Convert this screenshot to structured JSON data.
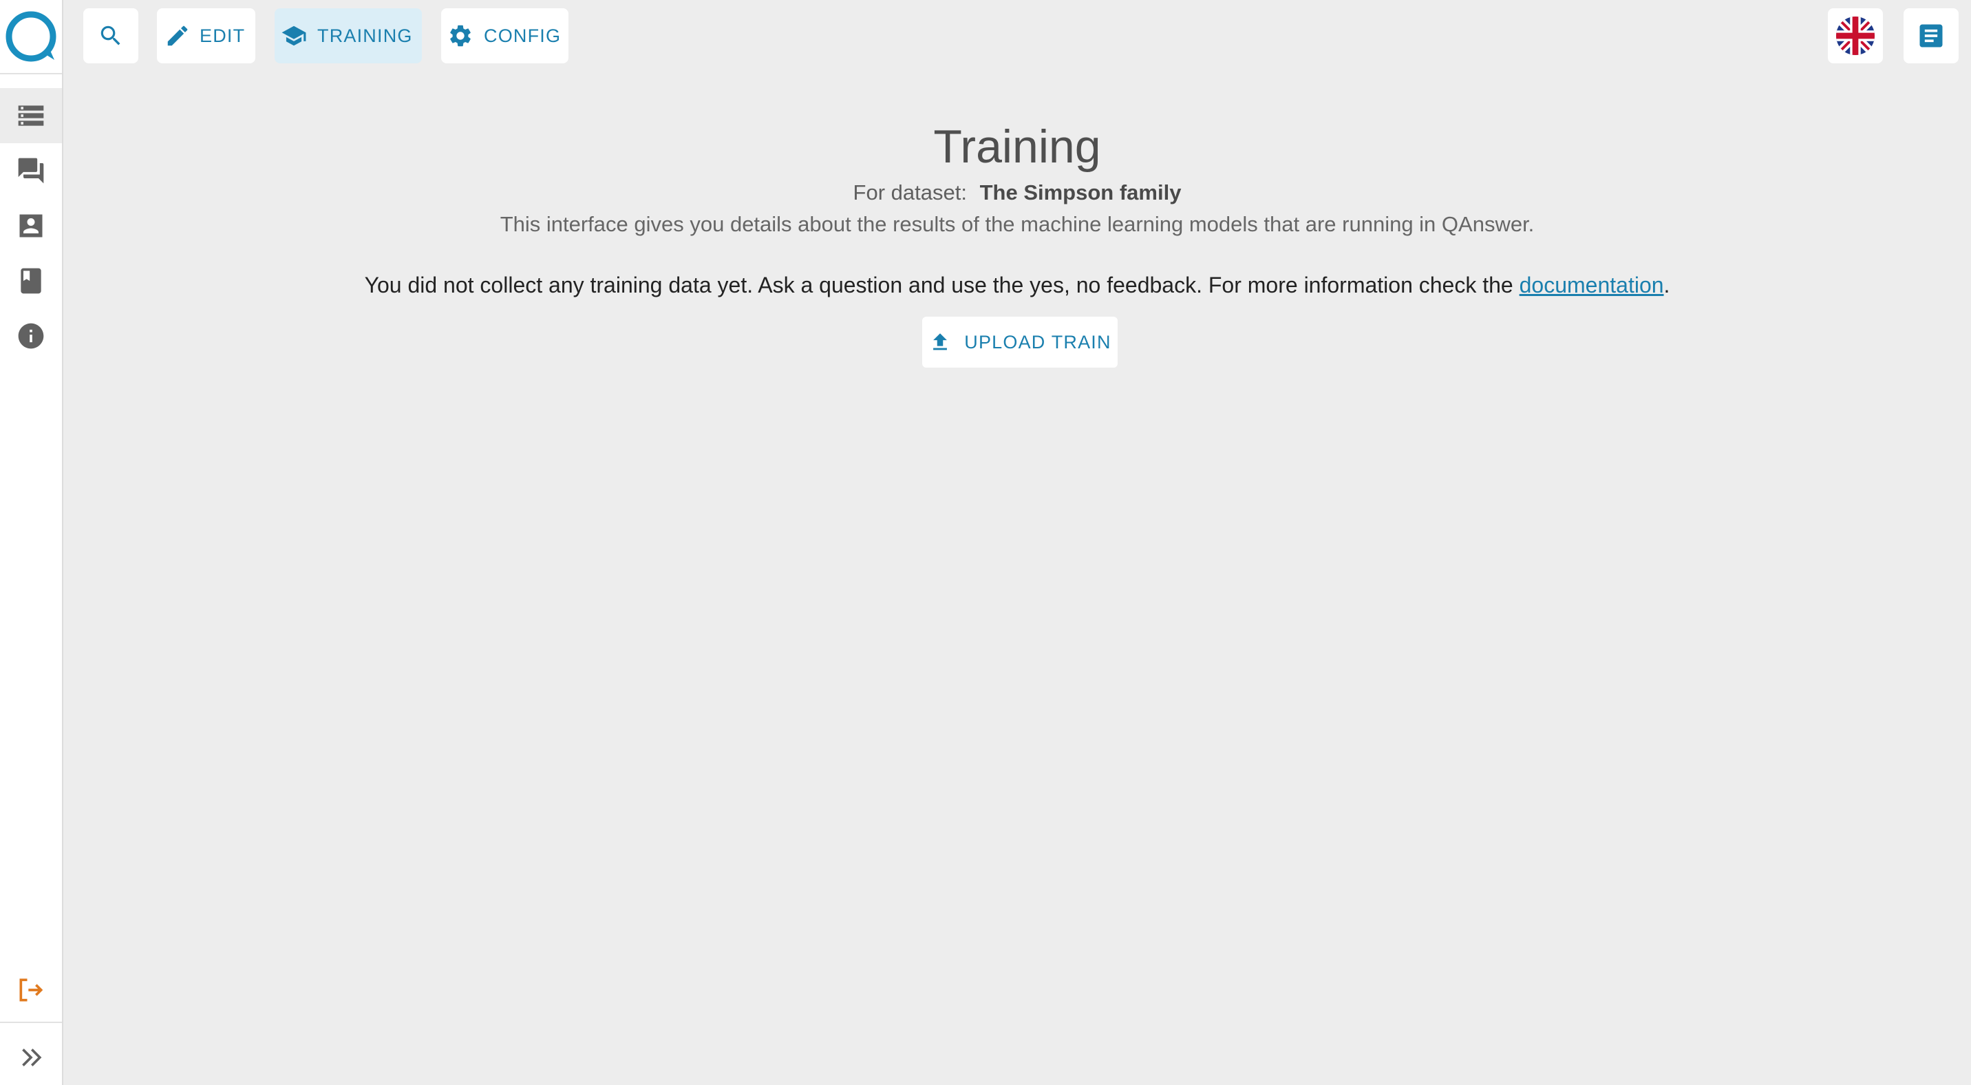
{
  "topbar": {
    "search_icon": "search-icon",
    "edit_label": "EDIT",
    "training_label": "TRAINING",
    "config_label": "CONFIG"
  },
  "sidebar": {
    "items": [
      {
        "name": "datasets",
        "icon": "storage-icon"
      },
      {
        "name": "conversations",
        "icon": "forum-icon"
      },
      {
        "name": "users",
        "icon": "contact-icon"
      },
      {
        "name": "docs",
        "icon": "book-icon"
      },
      {
        "name": "info",
        "icon": "info-icon"
      }
    ],
    "logout_icon": "logout-icon",
    "expand_icon": "double-chevron-icon"
  },
  "main": {
    "title": "Training",
    "dataset_prefix": "For dataset:",
    "dataset_name": "The Simpson family",
    "description": "This interface gives you details about the results of the machine learning models that are running in QAnswer.",
    "notice_text": "You did not collect any training data yet. Ask a question and use the yes, no feedback. For more information check the ",
    "notice_link": "documentation",
    "notice_end": ".",
    "upload_label": "UPLOAD TRAIN"
  },
  "colors": {
    "accent": "#1a7fae",
    "logout": "#e07a1f",
    "background": "#ededed"
  }
}
